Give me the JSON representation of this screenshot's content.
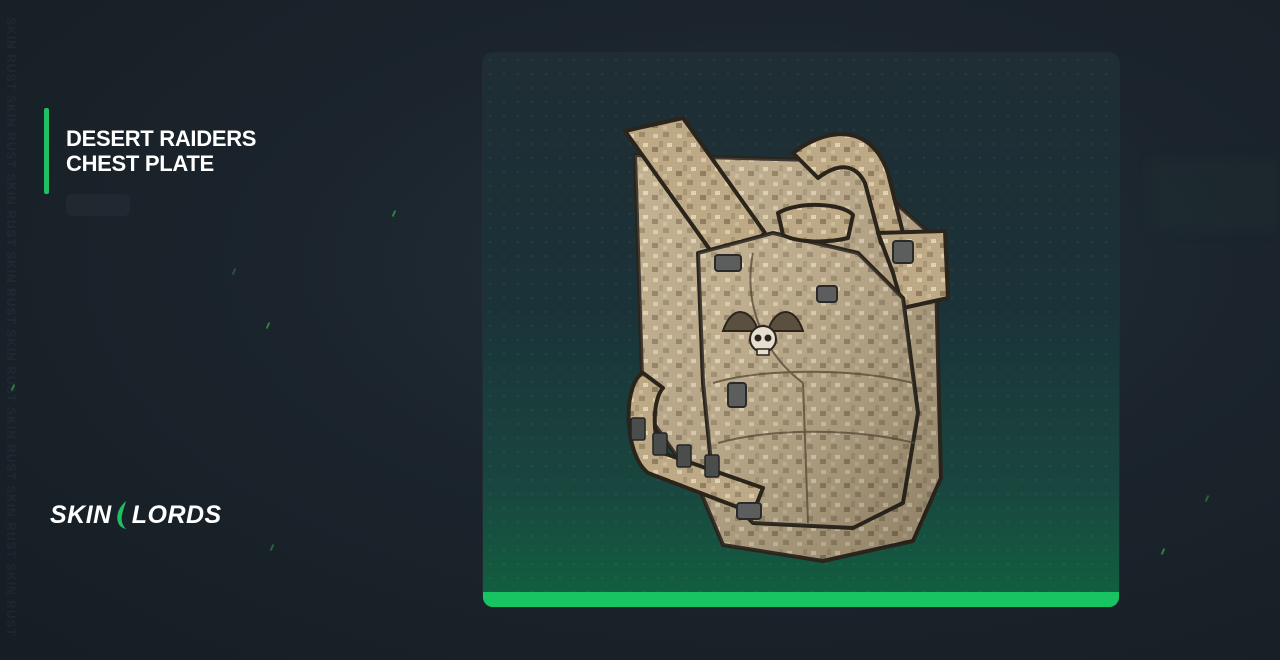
{
  "watermark": "SKIN RUST SKIN RUST SKIN RUST SKIN RUST SKIN RUST SKIN RUST SKIN RUST SKIN RUST",
  "title": {
    "line1": "DESERT RAIDERS",
    "line2": "CHEST PLATE"
  },
  "brand": {
    "left": "SKIN",
    "right": "LORDS"
  },
  "item_image": {
    "icon": "chest-plate-armor-icon"
  },
  "colors": {
    "accent": "#1fbf63",
    "background": "#1b242c",
    "camo_light": "#cdb993",
    "camo_dark": "#8a7a5c"
  }
}
